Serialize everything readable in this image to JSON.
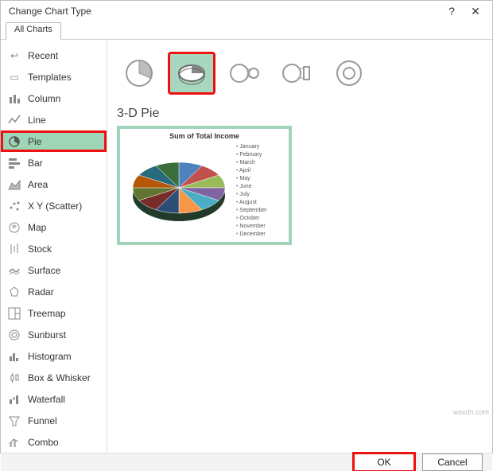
{
  "titlebar": {
    "title": "Change Chart Type",
    "help": "?",
    "close": "✕"
  },
  "tabs": {
    "all": "All Charts"
  },
  "sidebar": {
    "items": [
      {
        "label": "Recent"
      },
      {
        "label": "Templates"
      },
      {
        "label": "Column"
      },
      {
        "label": "Line"
      },
      {
        "label": "Pie"
      },
      {
        "label": "Bar"
      },
      {
        "label": "Area"
      },
      {
        "label": "X Y (Scatter)"
      },
      {
        "label": "Map"
      },
      {
        "label": "Stock"
      },
      {
        "label": "Surface"
      },
      {
        "label": "Radar"
      },
      {
        "label": "Treemap"
      },
      {
        "label": "Sunburst"
      },
      {
        "label": "Histogram"
      },
      {
        "label": "Box & Whisker"
      },
      {
        "label": "Waterfall"
      },
      {
        "label": "Funnel"
      },
      {
        "label": "Combo"
      }
    ]
  },
  "main": {
    "selected_subtype_label": "3-D Pie",
    "preview_title": "Sum of Total Income",
    "legend_items": [
      "January",
      "February",
      "March",
      "April",
      "May",
      "June",
      "July",
      "August",
      "September",
      "October",
      "November",
      "December"
    ]
  },
  "footer": {
    "ok": "OK",
    "cancel": "Cancel"
  },
  "watermark": "wsxdn.com",
  "chart_data": {
    "type": "pie",
    "title": "Sum of Total Income",
    "categories": [
      "January",
      "February",
      "March",
      "April",
      "May",
      "June",
      "July",
      "August",
      "September",
      "October",
      "November",
      "December"
    ],
    "values": [
      8,
      8,
      8,
      8,
      8,
      8,
      8,
      8,
      8,
      8,
      8,
      8
    ],
    "colors": [
      "#4f81bd",
      "#c0504d",
      "#9bbb59",
      "#8064a2",
      "#4bacc6",
      "#f79646",
      "#2c4d75",
      "#772c2a",
      "#5f7530",
      "#b65708",
      "#276a7c",
      "#3a6e3a"
    ],
    "style": "3d",
    "legend_position": "right"
  }
}
